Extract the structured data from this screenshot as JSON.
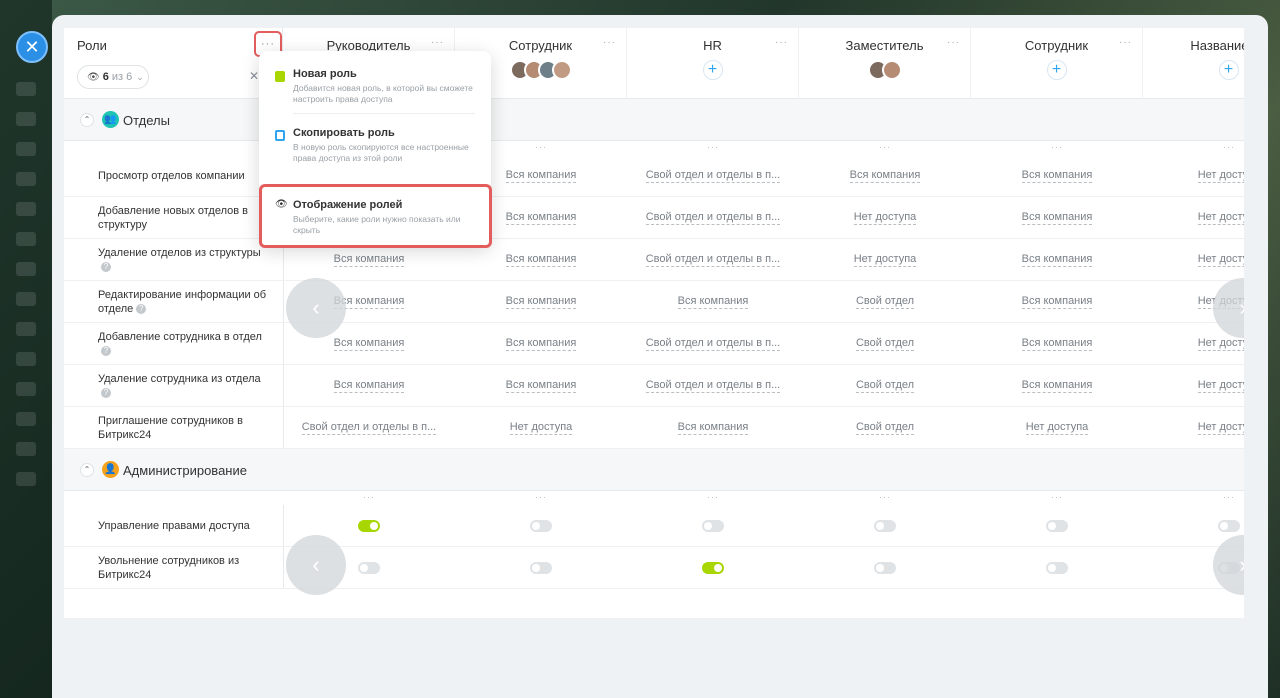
{
  "header": {
    "roles_title": "Роли",
    "more_label": "···",
    "filter": {
      "count": "6",
      "of": "из 6"
    },
    "columns": [
      {
        "name": "Руководитель",
        "members": "none"
      },
      {
        "name": "Сотрудник",
        "members": "avatars"
      },
      {
        "name": "HR",
        "members": "plus"
      },
      {
        "name": "Заместитель",
        "members": "avatars2"
      },
      {
        "name": "Сотрудник",
        "members": "plus"
      },
      {
        "name": "Название ро",
        "members": "plus"
      }
    ]
  },
  "menu": {
    "items": [
      {
        "title": "Новая роль",
        "desc": "Добавится новая роль, в которой вы сможете настроить права доступа"
      },
      {
        "title": "Скопировать роль",
        "desc": "В новую роль скопируются все настроенные права доступа из этой роли"
      },
      {
        "title": "Отображение ролей",
        "desc": "Выберите, какие роли нужно показать или скрыть"
      }
    ]
  },
  "sections": [
    {
      "title": "Отделы",
      "rows": [
        {
          "label": "Просмотр отделов компании",
          "help": false,
          "cells": [
            "",
            "Вся компания",
            "Свой отдел и отделы в п...",
            "Вся компания",
            "Вся компания",
            "Нет доступа"
          ]
        },
        {
          "label": "Добавление новых отделов в структуру",
          "help": false,
          "cells": [
            "",
            "Вся компания",
            "Свой отдел и отделы в п...",
            "Нет доступа",
            "Вся компания",
            "Нет доступа"
          ]
        },
        {
          "label": "Удаление отделов из структуры",
          "help": true,
          "cells": [
            "Вся компания",
            "Вся компания",
            "Свой отдел и отделы в п...",
            "Нет доступа",
            "Вся компания",
            "Нет доступа"
          ]
        },
        {
          "label": "Редактирование информации об отделе",
          "help": true,
          "cells": [
            "Вся компания",
            "Вся компания",
            "Вся компания",
            "Свой отдел",
            "Вся компания",
            "Нет доступа"
          ]
        },
        {
          "label": "Добавление сотрудника в отдел",
          "help": true,
          "cells": [
            "Вся компания",
            "Вся компания",
            "Свой отдел и отделы в п...",
            "Свой отдел",
            "Вся компания",
            "Нет доступа"
          ]
        },
        {
          "label": "Удаление сотрудника из отдела",
          "help": true,
          "cells": [
            "Вся компания",
            "Вся компания",
            "Свой отдел и отделы в п...",
            "Свой отдел",
            "Вся компания",
            "Нет доступа"
          ]
        },
        {
          "label": "Приглашение сотрудников в Битрикс24",
          "help": false,
          "cells": [
            "Свой отдел и отделы в п...",
            "Нет доступа",
            "Вся компания",
            "Свой отдел",
            "Нет доступа",
            "Нет доступа"
          ]
        }
      ]
    },
    {
      "title": "Администрирование",
      "rows": [
        {
          "label": "Управление правами доступа",
          "help": false,
          "toggles": [
            true,
            false,
            false,
            false,
            false,
            false
          ]
        },
        {
          "label": "Увольнение сотрудников из Битрикс24",
          "help": false,
          "toggles": [
            false,
            false,
            true,
            false,
            false,
            false
          ]
        }
      ]
    }
  ],
  "colors": {
    "accent": "#2fa5ef",
    "highlight": "#e35d5d",
    "toggle_on": "#a8d600",
    "section1_icon": "#1fc4b3",
    "section2_icon": "#f7a21b"
  }
}
